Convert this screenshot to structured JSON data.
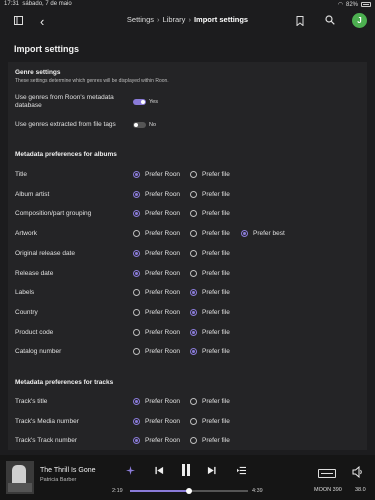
{
  "status_bar": {
    "time": "17:31",
    "date": "sábado, 7 de maio",
    "battery": "82%"
  },
  "breadcrumb": {
    "settings": "Settings",
    "library": "Library",
    "current": "Import settings"
  },
  "user": {
    "avatar_letter": "J"
  },
  "page": {
    "title": "Import settings"
  },
  "genre": {
    "title": "Genre settings",
    "description": "These settings determine which genres will be displayed within Roon.",
    "use_roon_label": "Use genres from Roon's metadata database",
    "use_roon_state": "Yes",
    "use_file_label": "Use genres extracted from file tags",
    "use_file_state": "No"
  },
  "option_labels": {
    "prefer_roon": "Prefer Roon",
    "prefer_file": "Prefer file",
    "prefer_best": "Prefer best"
  },
  "albums": {
    "title": "Metadata preferences for albums",
    "rows": [
      {
        "label": "Title",
        "selected": "prefer_roon"
      },
      {
        "label": "Album artist",
        "selected": "prefer_roon"
      },
      {
        "label": "Composition/part grouping",
        "selected": "prefer_roon"
      },
      {
        "label": "Artwork",
        "selected": "prefer_best"
      },
      {
        "label": "Original release date",
        "selected": "prefer_roon"
      },
      {
        "label": "Release date",
        "selected": "prefer_roon"
      },
      {
        "label": "Labels",
        "selected": "prefer_file"
      },
      {
        "label": "Country",
        "selected": "prefer_file"
      },
      {
        "label": "Product code",
        "selected": "prefer_file"
      },
      {
        "label": "Catalog number",
        "selected": "prefer_file"
      }
    ]
  },
  "tracks": {
    "title": "Metadata preferences for tracks",
    "rows": [
      {
        "label": "Track's title",
        "selected": "prefer_roon"
      },
      {
        "label": "Track's Media number",
        "selected": "prefer_roon"
      },
      {
        "label": "Track's Track number",
        "selected": "prefer_roon"
      }
    ]
  },
  "player": {
    "track_title": "The Thrill Is Gone",
    "artist": "Patricia Barber",
    "elapsed": "2:19",
    "duration": "4:39",
    "progress": 0.5,
    "zone": "MOON 390",
    "volume": "38.0",
    "accent_color": "#8a7bd8"
  }
}
